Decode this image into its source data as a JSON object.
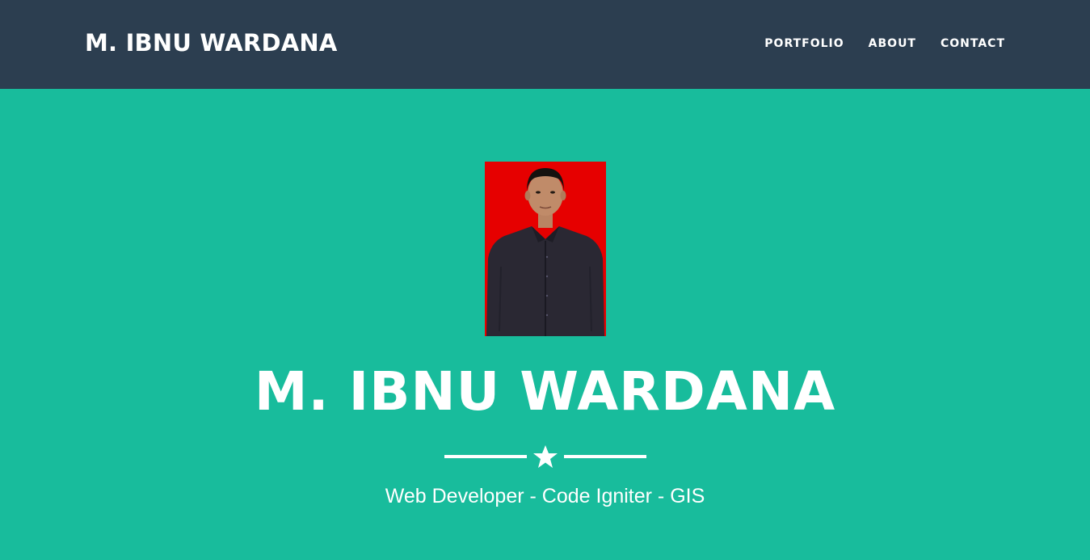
{
  "navbar": {
    "brand": "M. IBNU WARDANA",
    "links": [
      "PORTFOLIO",
      "ABOUT",
      "CONTACT"
    ]
  },
  "header": {
    "name": "M. IBNU WARDANA",
    "tagline": "Web Developer - Code Igniter - GIS",
    "divider_icon": "star-icon"
  },
  "colors": {
    "navbar_bg": "#2c3e50",
    "header_bg": "#18bc9c",
    "text": "#ffffff",
    "photo_bg": "#e60000"
  }
}
